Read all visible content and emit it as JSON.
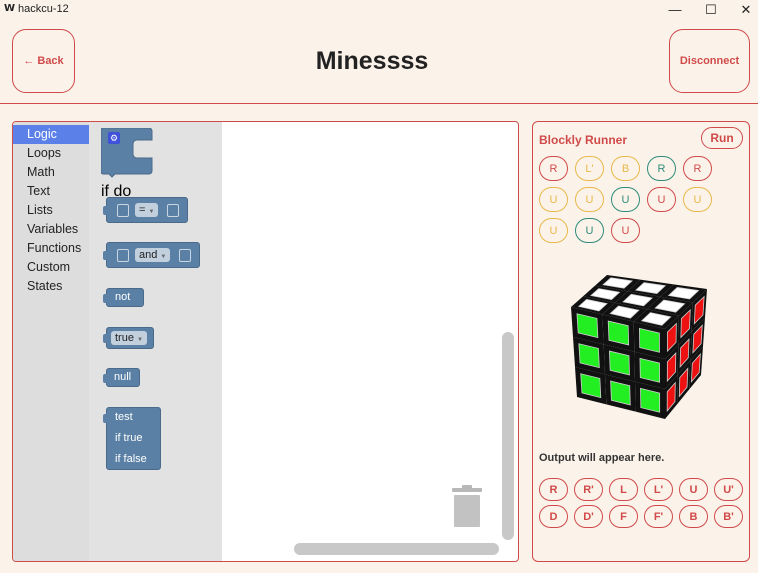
{
  "window": {
    "app_icon": "W",
    "title": "hackcu-12",
    "min_glyph": "—",
    "max_glyph": "☐",
    "close_glyph": "✕"
  },
  "header": {
    "back_label": "← Back",
    "title": "Minessss",
    "disconnect_label": "Disconnect"
  },
  "toolbox": {
    "items": [
      "Logic",
      "Loops",
      "Math",
      "Text",
      "Lists",
      "Variables",
      "Functions",
      "Custom",
      "States"
    ],
    "selected": "Logic"
  },
  "flyout": {
    "if_label": "if",
    "do_label": "do",
    "compare_op": "=",
    "logic_op": "and",
    "not_label": "not",
    "bool_value": "true",
    "null_label": "null",
    "ternary_test": "test",
    "ternary_true": "if true",
    "ternary_false": "if false"
  },
  "runner": {
    "title": "Blockly Runner",
    "run_label": "Run",
    "sequence": [
      {
        "label": "R",
        "color": "#d04a4a"
      },
      {
        "label": "L'",
        "color": "#e8b84a"
      },
      {
        "label": "B",
        "color": "#e8b84a"
      },
      {
        "label": "R",
        "color": "#2e8b7a"
      },
      {
        "label": "R",
        "color": "#d04a4a"
      },
      {
        "label": "U",
        "color": "#e8b84a"
      },
      {
        "label": "U",
        "color": "#e8b84a"
      },
      {
        "label": "U",
        "color": "#2e8b7a"
      },
      {
        "label": "U",
        "color": "#d04a4a"
      },
      {
        "label": "U",
        "color": "#e8b84a"
      },
      {
        "label": "U",
        "color": "#e8b84a"
      },
      {
        "label": "U",
        "color": "#2e8b7a"
      },
      {
        "label": "U",
        "color": "#d04a4a"
      }
    ],
    "output_text": "Output will appear here.",
    "moves": [
      "R",
      "R'",
      "L",
      "L'",
      "U",
      "U'",
      "D",
      "D'",
      "F",
      "F'",
      "B",
      "B'"
    ]
  },
  "colors": {
    "accent": "#d04a4a",
    "background": "#fbf3ea",
    "block": "#5b80a5",
    "cube_top": "#ffffff",
    "cube_front": "#22ee22",
    "cube_right": "#ee1111"
  }
}
